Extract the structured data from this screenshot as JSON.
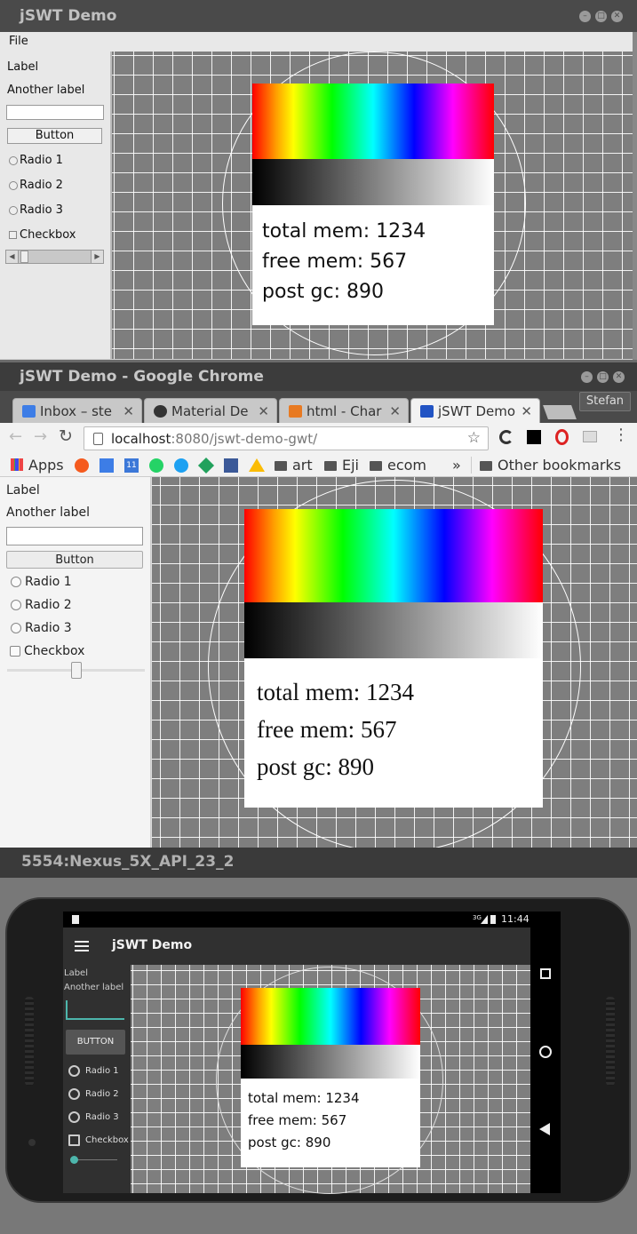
{
  "window1": {
    "title": "jSWT Demo",
    "menu": [
      "File"
    ],
    "label1": "Label",
    "label2": "Another label",
    "text_value": "",
    "button": "Button",
    "radios": [
      "Radio 1",
      "Radio 2",
      "Radio 3"
    ],
    "checkbox": "Checkbox",
    "mem": {
      "total": "total mem: 1234",
      "free": "free mem: 567",
      "post_gc": "post gc: 890"
    }
  },
  "window2": {
    "title": "jSWT Demo - Google Chrome",
    "tabs": [
      "Inbox – ste",
      "Material De",
      "html - Char",
      "jSWT Demo"
    ],
    "profile": "Stefan",
    "url": {
      "host": "localhost",
      "rest": ":8080/jswt-demo-gwt/"
    },
    "bookmarks": {
      "apps": "Apps",
      "folders": [
        "art",
        "Eji",
        "ecom"
      ],
      "overflow": "»",
      "other": "Other bookmarks"
    },
    "label1": "Label",
    "label2": "Another label",
    "text_value": "",
    "button": "Button",
    "radios": [
      "Radio 1",
      "Radio 2",
      "Radio 3"
    ],
    "checkbox": "Checkbox",
    "mem": {
      "total": "total mem: 1234",
      "free": "free mem: 567",
      "post_gc": "post gc: 890"
    }
  },
  "window3": {
    "title": "5554:Nexus_5X_API_23_2",
    "status_time": "11:44",
    "status_signal": "3G",
    "app_title": "jSWT Demo",
    "label1": "Label",
    "label2": "Another label",
    "button": "BUTTON",
    "radios": [
      "Radio 1",
      "Radio 2",
      "Radio 3"
    ],
    "checkbox": "Checkbox",
    "mem": {
      "total": "total mem: 1234",
      "free": "free mem: 567",
      "post_gc": "post gc: 890"
    }
  },
  "icons": [
    "minimize-icon",
    "maximize-icon",
    "close-icon",
    "back-icon",
    "forward-icon",
    "reload-icon",
    "star-icon",
    "menu-icon",
    "home-icon",
    "recents-icon",
    "hamburger-icon"
  ]
}
